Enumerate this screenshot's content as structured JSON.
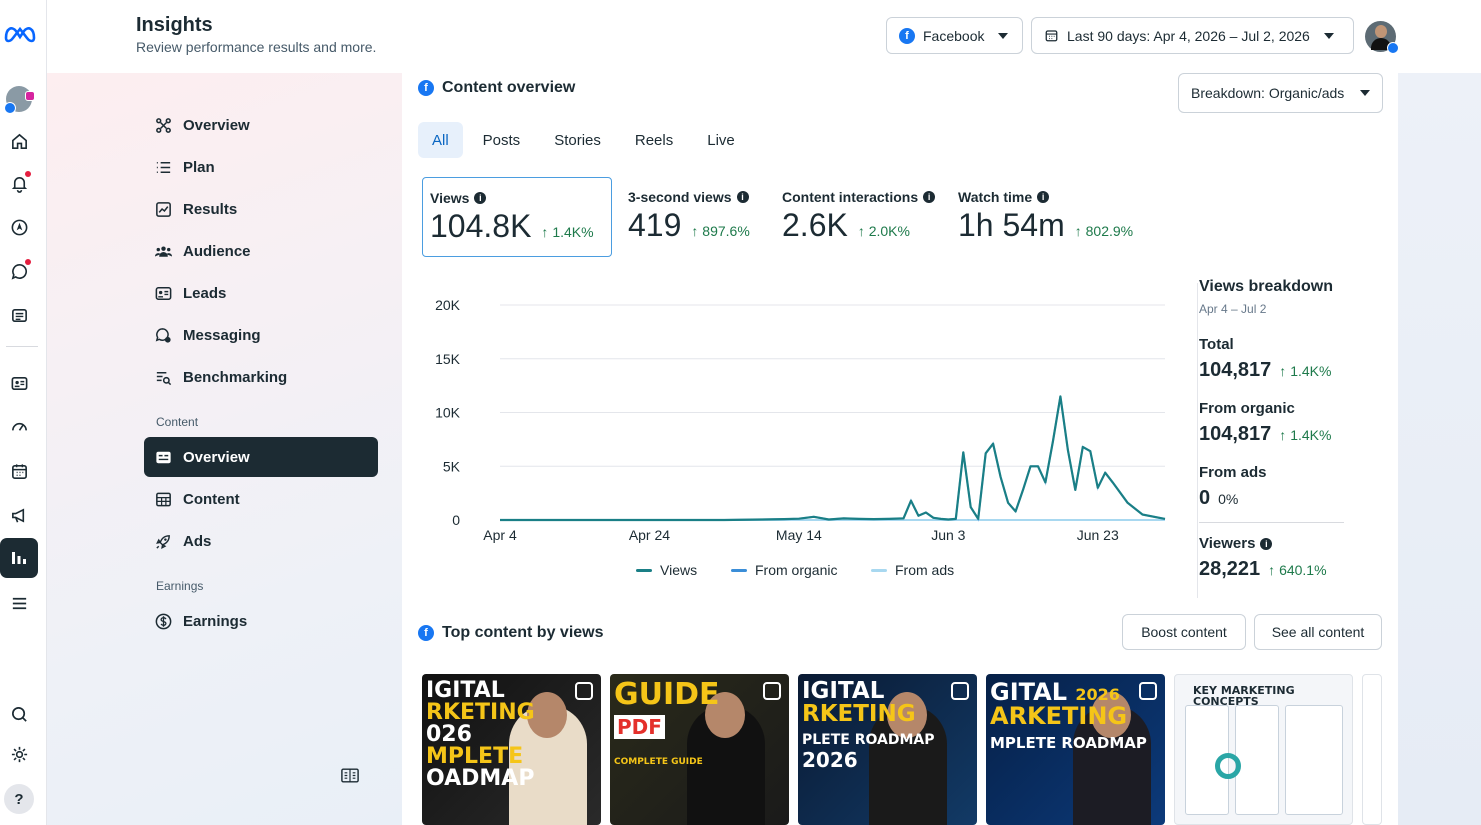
{
  "header": {
    "title": "Insights",
    "subtitle": "Review performance results and more.",
    "platform_select": "Facebook",
    "date_range": "Last 90 days: Apr 4, 2026 – Jul 2, 2026"
  },
  "rail": {
    "icons": [
      "meta-logo-icon",
      "profile-avatar-icon",
      "home-icon",
      "bell-icon",
      "compass-icon",
      "chat-icon",
      "pages-icon",
      "contact-card-icon",
      "gauge-icon",
      "calendar-icon",
      "megaphone-icon",
      "bar-chart-icon",
      "menu-icon",
      "search-icon",
      "gear-icon",
      "help-icon"
    ]
  },
  "sidebar": {
    "items": [
      {
        "label": "Overview"
      },
      {
        "label": "Plan"
      },
      {
        "label": "Results"
      },
      {
        "label": "Audience"
      },
      {
        "label": "Leads"
      },
      {
        "label": "Messaging"
      },
      {
        "label": "Benchmarking"
      }
    ],
    "content_heading": "Content",
    "content_items": [
      {
        "label": "Overview"
      },
      {
        "label": "Content"
      },
      {
        "label": "Ads"
      }
    ],
    "earnings_heading": "Earnings",
    "earnings_items": [
      {
        "label": "Earnings"
      }
    ]
  },
  "content_overview": {
    "title": "Content overview",
    "breakdown_select": "Breakdown: Organic/ads",
    "tabs": [
      "All",
      "Posts",
      "Stories",
      "Reels",
      "Live"
    ],
    "metrics": [
      {
        "label": "Views",
        "value": "104.8K",
        "change": "1.4K%"
      },
      {
        "label": "3-second views",
        "value": "419",
        "change": "897.6%"
      },
      {
        "label": "Content interactions",
        "value": "2.6K",
        "change": "2.0K%"
      },
      {
        "label": "Watch time",
        "value": "1h 54m",
        "change": "802.9%"
      }
    ]
  },
  "chart_data": {
    "type": "line",
    "x_tick_labels": [
      "Apr 4",
      "Apr 24",
      "May 14",
      "Jun 3",
      "Jun 23"
    ],
    "y_tick_labels": [
      "0",
      "5K",
      "10K",
      "15K",
      "20K"
    ],
    "ylim": [
      0,
      20000
    ],
    "x_range_days": [
      0,
      89
    ],
    "legend": [
      "Views",
      "From organic",
      "From ads"
    ],
    "series": [
      {
        "name": "Views",
        "color": "#1a7f86",
        "x_day": [
          0,
          5,
          10,
          15,
          20,
          25,
          30,
          35,
          38,
          40,
          42,
          44,
          46,
          48,
          50,
          52,
          54,
          55,
          56,
          57,
          58,
          59,
          60,
          61,
          62,
          63,
          64,
          65,
          66,
          67,
          68,
          69,
          70,
          71,
          72,
          73,
          74,
          75,
          76,
          77,
          78,
          79,
          80,
          81,
          82,
          84,
          86,
          89
        ],
        "y": [
          0,
          0,
          0,
          0,
          0,
          0,
          0,
          50,
          80,
          120,
          300,
          50,
          150,
          100,
          80,
          100,
          150,
          1800,
          400,
          700,
          200,
          100,
          50,
          100,
          6300,
          1200,
          100,
          6200,
          7100,
          4000,
          1600,
          800,
          2800,
          5000,
          5000,
          3500,
          7300,
          11500,
          6500,
          2800,
          6800,
          6400,
          3000,
          4400,
          3500,
          1600,
          500,
          100
        ]
      },
      {
        "name": "From organic",
        "color": "#3b8ed8",
        "same_as": "Views"
      },
      {
        "name": "From ads",
        "color": "#a8d8f0",
        "y": [
          0
        ]
      }
    ]
  },
  "views_breakdown": {
    "title": "Views breakdown",
    "range": "Apr 4 – Jul 2",
    "items": [
      {
        "label": "Total",
        "value": "104,817",
        "change": "1.4K%"
      },
      {
        "label": "From organic",
        "value": "104,817",
        "change": "1.4K%"
      },
      {
        "label": "From ads",
        "value": "0",
        "pct": "0%"
      }
    ],
    "viewers": {
      "label": "Viewers",
      "value": "28,221",
      "change": "640.1%"
    }
  },
  "top_content": {
    "title": "Top content by views",
    "boost_button": "Boost content",
    "see_all_button": "See all content",
    "thumbs": [
      {
        "text": "IGITAL\nRKETING\n026\nMPLETE\nOADMAP",
        "bg": "#1a1a1a",
        "accent": "#f5c518"
      },
      {
        "text": "GUIDE\nPDF\nCOMPLETE GUIDE",
        "bg": "#1c1c1c",
        "accent": "#f5c518"
      },
      {
        "text": "IGITAL\nRKETING\nPLETE ROADMAP\n2026",
        "bg": "#0f2742",
        "accent": "#f5c518"
      },
      {
        "text": "GITAL 2026\nARKETING\nMPLETE ROADMAP",
        "bg": "#0a2a55",
        "accent": "#f5c518"
      },
      {
        "text": "KEY MARKETING CONCEPTS",
        "bg": "#f4f6f9",
        "accent": "#1c2b33"
      }
    ]
  }
}
